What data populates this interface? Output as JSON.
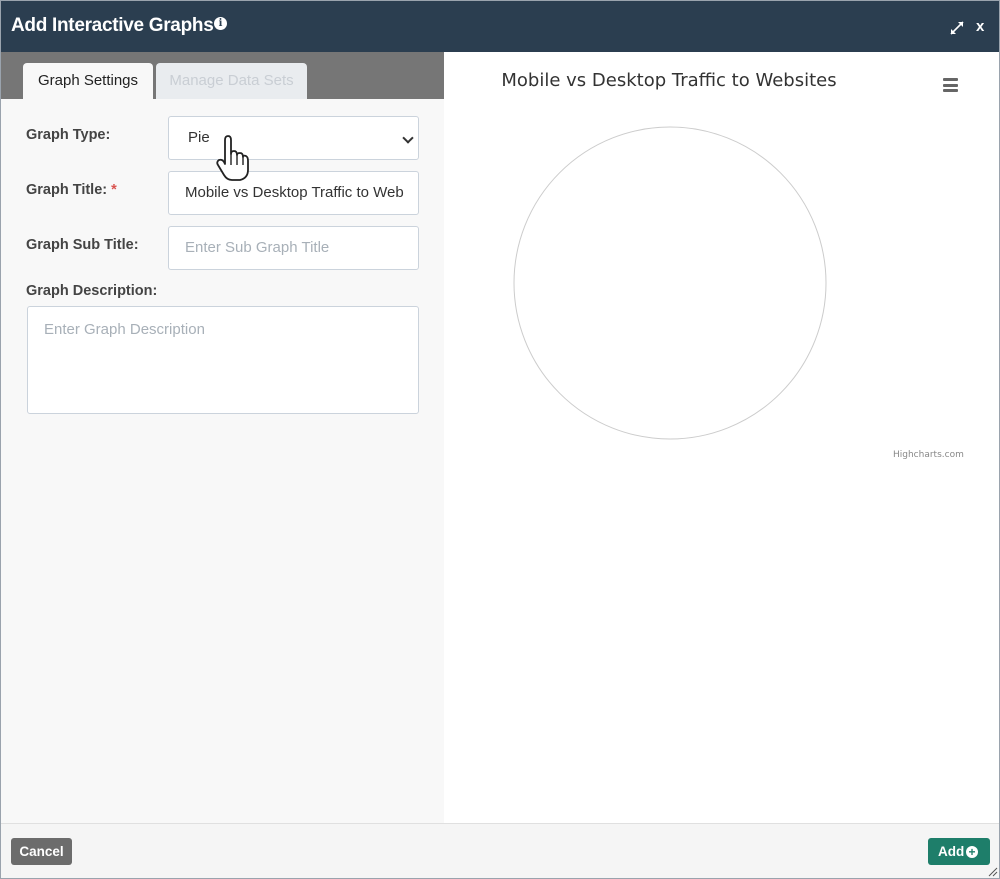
{
  "dialog": {
    "title": "Add Interactive Graphs",
    "close_label": "x"
  },
  "tabs": [
    {
      "label": "Graph Settings",
      "active": true
    },
    {
      "label": "Manage Data Sets",
      "active": false
    }
  ],
  "form": {
    "graph_type": {
      "label": "Graph Type:",
      "value": "Pie"
    },
    "graph_title": {
      "label": "Graph Title:",
      "required_mark": "*",
      "value": "Mobile vs Desktop Traffic to Web"
    },
    "graph_subtitle": {
      "label": "Graph Sub Title:",
      "placeholder": "Enter Sub Graph Title"
    },
    "graph_description": {
      "label": "Graph Description:",
      "placeholder": "Enter Graph Description"
    }
  },
  "preview": {
    "title": "Mobile vs Desktop Traffic to Websites",
    "credits": "Highcharts.com"
  },
  "chart_data": {
    "type": "pie",
    "title": "Mobile vs Desktop Traffic to Websites",
    "series": []
  },
  "footer": {
    "cancel_label": "Cancel",
    "add_label": "Add"
  },
  "colors": {
    "titlebar": "#2b3e50",
    "tabbar": "#767676",
    "add_button": "#1e7e6a",
    "cancel_button": "#6c6c6c"
  }
}
